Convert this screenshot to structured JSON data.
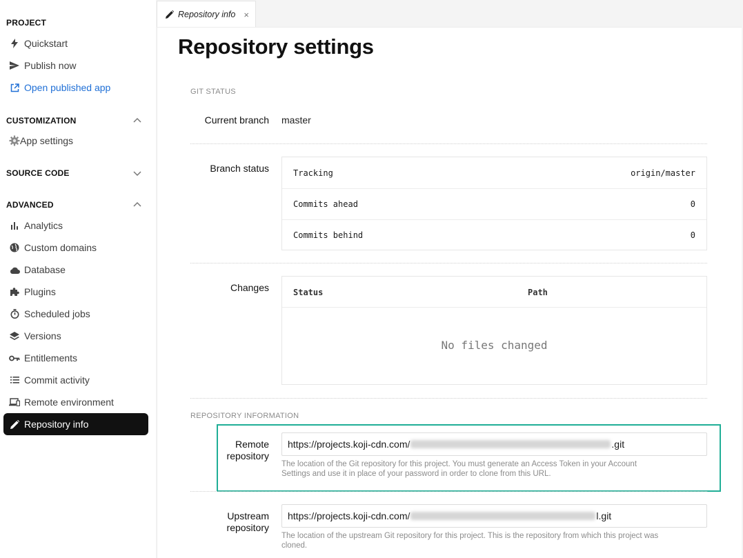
{
  "sidebar": {
    "sections": {
      "project": {
        "title": "PROJECT"
      },
      "customization": {
        "title": "CUSTOMIZATION",
        "chevron": "chevron-up-icon"
      },
      "source_code": {
        "title": "SOURCE CODE",
        "chevron": "chevron-down-icon"
      },
      "advanced": {
        "title": "ADVANCED",
        "chevron": "chevron-up-icon"
      }
    },
    "items": {
      "quickstart": {
        "label": "Quickstart",
        "icon": "bolt-icon"
      },
      "publish_now": {
        "label": "Publish now",
        "icon": "send-icon"
      },
      "open_published_app": {
        "label": "Open published app",
        "icon": "external-link-icon",
        "color": "#1f6fd6"
      },
      "app_settings": {
        "label": "App settings",
        "icon": "gear-icon"
      },
      "analytics": {
        "label": "Analytics",
        "icon": "bar-chart-icon"
      },
      "custom_domains": {
        "label": "Custom domains",
        "icon": "globe-icon"
      },
      "database": {
        "label": "Database",
        "icon": "cloud-icon"
      },
      "plugins": {
        "label": "Plugins",
        "icon": "puzzle-icon"
      },
      "scheduled_jobs": {
        "label": "Scheduled jobs",
        "icon": "timer-icon"
      },
      "versions": {
        "label": "Versions",
        "icon": "layers-icon"
      },
      "entitlements": {
        "label": "Entitlements",
        "icon": "key-icon"
      },
      "commit_activity": {
        "label": "Commit activity",
        "icon": "list-icon"
      },
      "remote_environment": {
        "label": "Remote environment",
        "icon": "laptop-icon"
      },
      "repository_info": {
        "label": "Repository info",
        "icon": "pencil-icon",
        "active": true
      }
    }
  },
  "tab": {
    "label": "Repository info",
    "icon": "pencil-icon",
    "close": "×"
  },
  "page": {
    "title": "Repository settings",
    "git_status": {
      "heading": "GIT STATUS",
      "current_branch": {
        "label": "Current branch",
        "value": "master"
      },
      "branch_status": {
        "label": "Branch status",
        "rows": [
          {
            "key": "Tracking",
            "value": "origin/master"
          },
          {
            "key": "Commits ahead",
            "value": "0"
          },
          {
            "key": "Commits behind",
            "value": "0"
          }
        ]
      },
      "changes": {
        "label": "Changes",
        "columns": [
          "Status",
          "Path"
        ],
        "empty_text": "No files changed"
      }
    },
    "repository_information": {
      "heading": "REPOSITORY INFORMATION",
      "remote": {
        "label_line1": "Remote",
        "label_line2": "repository",
        "url_prefix": "https://projects.koji-cdn.com/",
        "url_suffix": ".git",
        "help_line1": "The location of the Git repository for this project. You must generate an Access Token in your Account",
        "help_line2": "Settings and use it in place of your password in order to clone from this URL."
      },
      "upstream": {
        "label_line1": "Upstream",
        "label_line2": "repository",
        "url_prefix": "https://projects.koji-cdn.com/",
        "url_suffix": "l.git",
        "help_line1": "The location of the upstream Git repository for this project. This is the repository from which this project was",
        "help_line2": "cloned."
      }
    }
  },
  "colors": {
    "accent_link": "#1f6fd6",
    "active_nav_bg": "#111111",
    "highlight_border": "#1fae96"
  }
}
